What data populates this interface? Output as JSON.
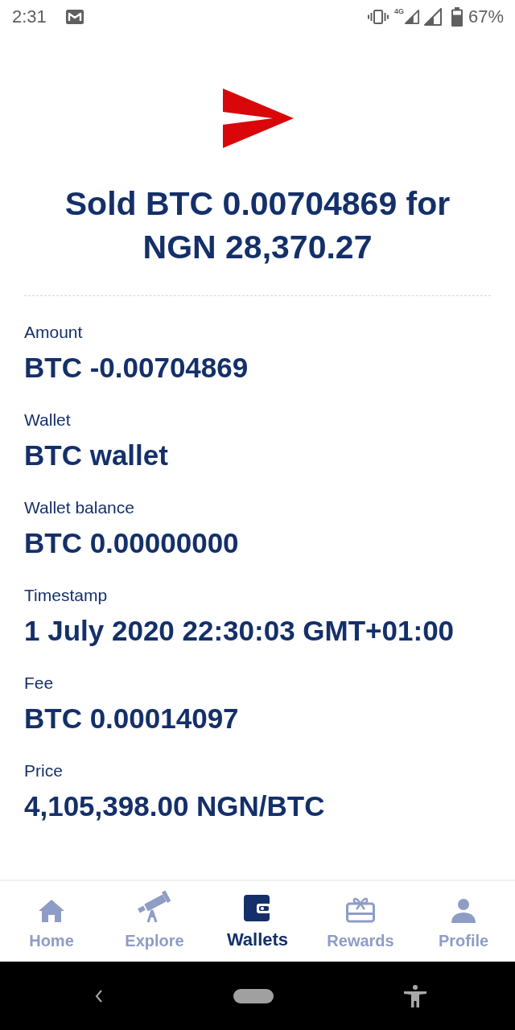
{
  "status_bar": {
    "time": "2:31",
    "network": "4G",
    "battery": "67%"
  },
  "header": {
    "title": "Sold BTC 0.00704869 for NGN 28,370.27"
  },
  "details": [
    {
      "label": "Amount",
      "value": "BTC -0.00704869"
    },
    {
      "label": "Wallet",
      "value": "BTC wallet"
    },
    {
      "label": "Wallet balance",
      "value": "BTC 0.00000000"
    },
    {
      "label": "Timestamp",
      "value": "1 July 2020 22:30:03 GMT+01:00"
    },
    {
      "label": "Fee",
      "value": "BTC 0.00014097"
    },
    {
      "label": "Price",
      "value": "4,105,398.00 NGN/BTC"
    }
  ],
  "bottom_nav": [
    {
      "label": "Home",
      "selected": false
    },
    {
      "label": "Explore",
      "selected": false
    },
    {
      "label": "Wallets",
      "selected": true
    },
    {
      "label": "Rewards",
      "selected": false
    },
    {
      "label": "Profile",
      "selected": false
    }
  ]
}
